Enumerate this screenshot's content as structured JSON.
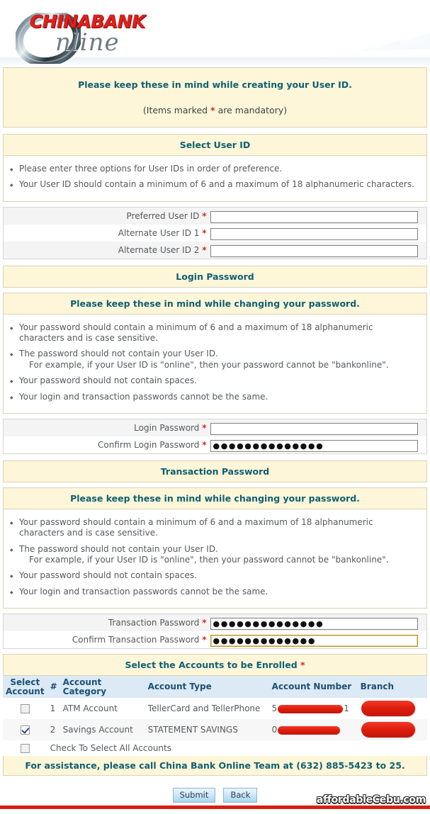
{
  "brand": {
    "logo_primary": "CHINABANK",
    "logo_secondary": "nline",
    "logo_icon": "metallic-o-ring"
  },
  "intro": {
    "heading": "Please keep these in mind while creating your User ID.",
    "mandatory_note_prefix": "(Items marked ",
    "mandatory_asterisk": "*",
    "mandatory_note_suffix": " are mandatory)"
  },
  "select_user_id": {
    "title": "Select User ID",
    "notes": [
      "Please enter three options for User IDs in order of preference.",
      "Your User ID should contain a minimum of 6 and a maximum of 18 alphanumeric characters."
    ],
    "fields": [
      {
        "label": "Preferred User ID",
        "required": "*",
        "value": "",
        "placeholder": ""
      },
      {
        "label": "Alternate User ID 1",
        "required": "*",
        "value": "",
        "placeholder": ""
      },
      {
        "label": "Alternate User ID 2",
        "required": "*",
        "value": "",
        "placeholder": ""
      }
    ]
  },
  "login_password": {
    "title": "Login Password",
    "notes_heading": "Please keep these in mind while changing your password.",
    "notes": [
      "Your password should contain a minimum of 6 and a maximum of 18 alphanumeric characters and is case sensitive.",
      "The password should not contain your User ID.",
      "Your password should not contain spaces.",
      "Your login and transaction passwords cannot be the same."
    ],
    "note_example": "For example, if your User ID is \"online\", then your password cannot be \"bankonline\".",
    "fields": [
      {
        "label": "Login Password",
        "required": "*",
        "value": "",
        "placeholder": ""
      },
      {
        "label": "Confirm Login Password",
        "required": "*",
        "value": "●●●●●●●●●●●●●●",
        "placeholder": ""
      }
    ]
  },
  "transaction_password": {
    "title": "Transaction Password",
    "notes_heading": "Please keep these in mind while changing your password.",
    "notes": [
      "Your password should contain a minimum of 6 and a maximum of 18 alphanumeric characters and is case sensitive.",
      "The password should not contain your User ID.",
      "Your password should not contain spaces.",
      "Your login and transaction passwords cannot be the same."
    ],
    "note_example": "For example, if your User ID is \"online\", then your password cannot be \"bankonline\".",
    "fields": [
      {
        "label": "Transaction Password",
        "required": "*",
        "value": "●●●●●●●●●●●●●●",
        "placeholder": ""
      },
      {
        "label": "Confirm Transaction Password",
        "required": "*",
        "value": "●●●●●●●●●●●●●",
        "placeholder": ""
      }
    ]
  },
  "accounts": {
    "title": "Select the Accounts to be Enrolled",
    "title_asterisk": "*",
    "columns": {
      "select": "Select Account",
      "select_line1": "Select",
      "select_line2": "Account",
      "num": "#",
      "category": "Account Category",
      "type": "Account Type",
      "number": "Account Number",
      "branch": "Branch"
    },
    "rows": [
      {
        "checked": false,
        "num": "1",
        "category": "ATM Account",
        "type": "TellerCard and TellerPhone",
        "number_prefix": "5",
        "number_suffix": "1",
        "number_redacted": true,
        "branch_redacted": true
      },
      {
        "checked": true,
        "num": "2",
        "category": "Savings Account",
        "type": "STATEMENT SAVINGS",
        "number_prefix": "0",
        "number_suffix": "",
        "number_redacted": true,
        "branch_redacted": true
      }
    ],
    "select_all_label": "Check To Select All Accounts",
    "select_all_checked": false
  },
  "assistance": "For assistance, please call China Bank Online Team at (632) 885-5423 to 25.",
  "footer": {
    "submit_label": "Submit",
    "back_label": "Back",
    "watermark": "affordableCebu.com"
  },
  "colors": {
    "panel_yellow": "#fdf6d8",
    "teal_heading": "#0f5f73",
    "table_header_blue": "#dbeaf5",
    "redaction_red": "#e01d0d",
    "bottom_rule_red": "#d81f12",
    "brand_red": "#e2201c"
  }
}
